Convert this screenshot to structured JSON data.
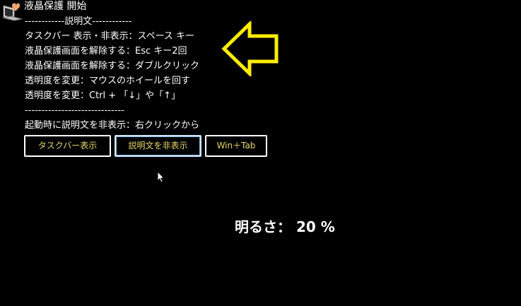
{
  "window": {
    "title": "液晶保護 開始"
  },
  "description": {
    "lines": [
      "------------説明文------------",
      "タスクバー 表示・非表示：スペース キー",
      "液晶保護画面を解除する：Esc キー2回",
      "液晶保護画面を解除する：ダブルクリック",
      "透明度を変更：マウスのホイールを回す",
      "透明度を変更：Ctrl + 「↓」や「↑」",
      "------------------------------",
      "起動時に説明文を非表示：右クリックから"
    ]
  },
  "buttons": {
    "taskbar_label": "タスクバー表示",
    "hide_description_label": "説明文を非表示",
    "win_tab_label": "Win＋Tab"
  },
  "brightness": {
    "label": "明るさ：",
    "value": "20",
    "unit": "%"
  },
  "colors": {
    "background": "#000000",
    "text": "#ffffff",
    "button_text": "#e8d868",
    "arrow": "#ffee00"
  },
  "icons": {
    "app": "heart-laptop-icon",
    "arrow": "left-arrow-icon",
    "cursor": "mouse-cursor-icon"
  }
}
